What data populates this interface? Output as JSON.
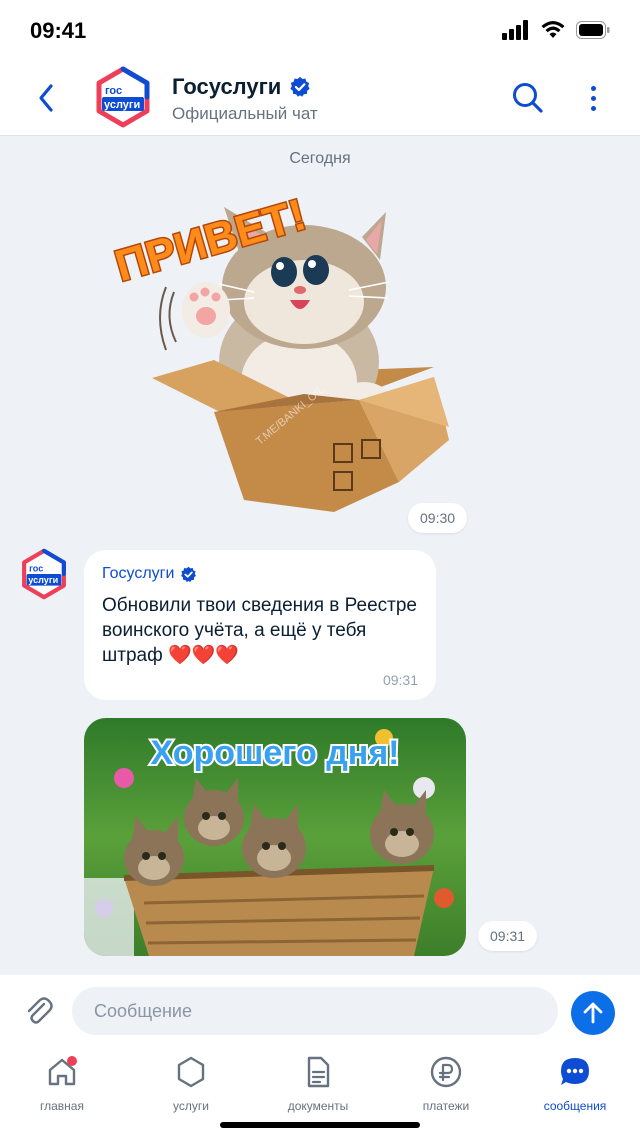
{
  "status_bar": {
    "time": "09:41"
  },
  "header": {
    "title": "Госуслуги",
    "subtitle": "Официальный чат",
    "logo_text_top": "гос",
    "logo_text_bottom": "услуги"
  },
  "chat": {
    "date_separator": "Сегодня",
    "messages": [
      {
        "type": "sticker",
        "sticker_text": "ПРИВЕТ!",
        "watermark": "T.ME/BANKI_OIL",
        "time": "09:30"
      },
      {
        "type": "text",
        "sender": "Госуслуги",
        "text": "Обновили твои сведения в Реестре воинского учёта, а ещё у тебя штраф ❤️❤️❤️",
        "time": "09:31"
      },
      {
        "type": "image",
        "image_text": "Хорошего дня!",
        "time": "09:31"
      }
    ]
  },
  "composer": {
    "placeholder": "Сообщение"
  },
  "tabs": [
    {
      "label": "главная",
      "icon": "home-icon",
      "badge": true
    },
    {
      "label": "услуги",
      "icon": "hexagon-icon"
    },
    {
      "label": "документы",
      "icon": "document-icon"
    },
    {
      "label": "платежи",
      "icon": "ruble-icon"
    },
    {
      "label": "сообщения",
      "icon": "chat-bubble-icon",
      "active": true
    }
  ],
  "colors": {
    "accent": "#0d4cd3",
    "send_button": "#0d6fe8",
    "logo_red": "#ee3f58",
    "background": "#eef1f6",
    "notification_dot": "#ee3f58"
  }
}
